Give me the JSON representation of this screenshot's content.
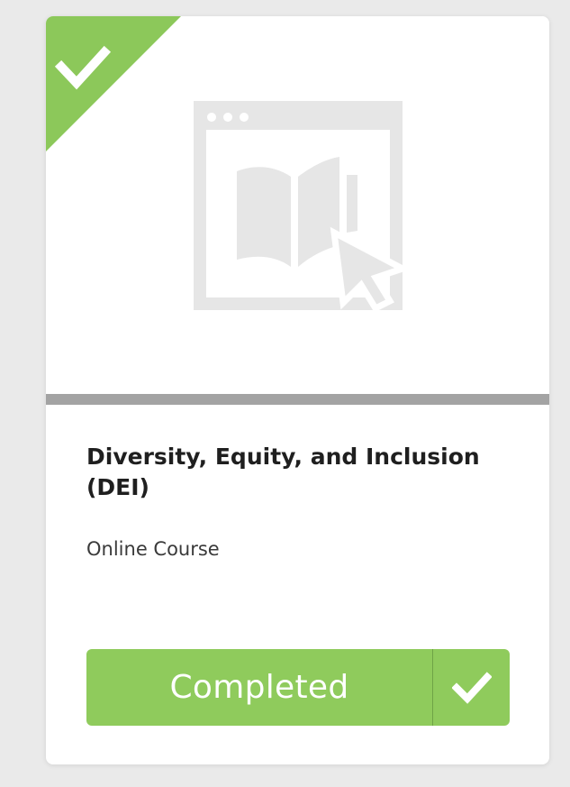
{
  "course": {
    "title": "Diversity, Equity, and Inclusion (DEI)",
    "type": "Online Course",
    "status_label": "Completed",
    "progress": 1.0,
    "thumbnail_icon": "online-course-icon",
    "completed_badge_icon": "checkmark-icon"
  },
  "colors": {
    "accent_green": "#8fcb5c",
    "ribbon_green": "#8cc85a",
    "progress_gray": "#a3a3a3",
    "icon_gray": "#e6e6e6"
  }
}
